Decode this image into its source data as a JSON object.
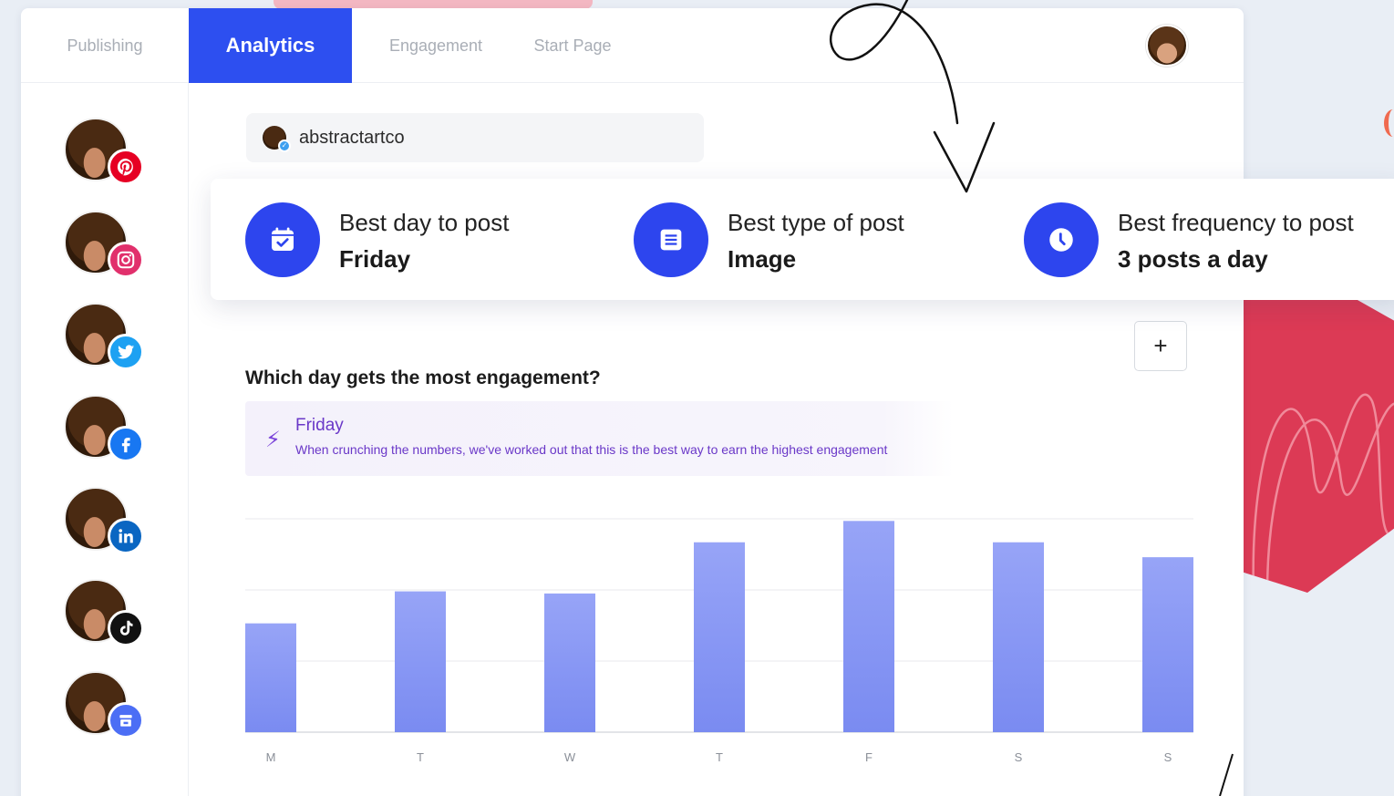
{
  "nav": {
    "tabs": [
      {
        "label": "Publishing"
      },
      {
        "label": "Analytics"
      },
      {
        "label": "Engagement"
      },
      {
        "label": "Start Page"
      }
    ],
    "active_tab": "Analytics"
  },
  "sidebar": {
    "profiles": [
      {
        "network": "pinterest",
        "icon": "pinterest-icon",
        "color": "#e60023"
      },
      {
        "network": "instagram",
        "icon": "instagram-icon",
        "color": "#e1306c"
      },
      {
        "network": "twitter",
        "icon": "twitter-icon",
        "color": "#1da1f2"
      },
      {
        "network": "facebook",
        "icon": "facebook-icon",
        "color": "#1877f2"
      },
      {
        "network": "linkedin",
        "icon": "linkedin-icon",
        "color": "#0a66c2"
      },
      {
        "network": "tiktok",
        "icon": "tiktok-icon",
        "color": "#111111"
      },
      {
        "network": "google-business",
        "icon": "store-icon",
        "color": "#4c6ef5"
      }
    ]
  },
  "account": {
    "name": "abstractartco"
  },
  "best": [
    {
      "label": "Best day to post",
      "value": "Friday",
      "icon": "calendar-icon"
    },
    {
      "label": "Best type of post",
      "value": "Image",
      "icon": "document-icon"
    },
    {
      "label": "Best frequency to post",
      "value": "3 posts a day",
      "icon": "clock-icon"
    }
  ],
  "engagement": {
    "title": "Which day gets the most engagement?",
    "add_button": "+",
    "insight_title": "Friday",
    "insight_text": "When crunching the numbers, we've worked out that this is the best way to earn the highest engagement"
  },
  "chart_data": {
    "type": "bar",
    "categories": [
      "M",
      "T",
      "W",
      "T",
      "F",
      "S",
      "S"
    ],
    "values": [
      51,
      66,
      65,
      89,
      99,
      89,
      82
    ],
    "ylim": [
      0,
      100
    ],
    "grid": true,
    "bar_color": "#8a9af5",
    "highlight": "F"
  },
  "colors": {
    "accent": "#2d4ff0",
    "insight": "#6a38c8"
  }
}
